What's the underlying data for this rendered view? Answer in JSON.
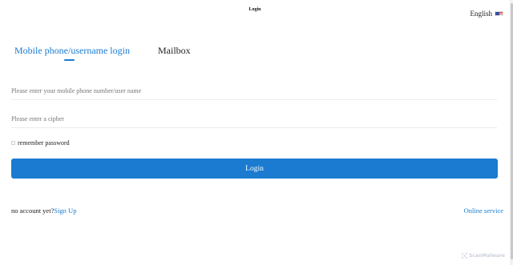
{
  "header": {
    "title": "Login",
    "language": "English",
    "flag_icon": "us-flag-icon"
  },
  "tabs": [
    {
      "label": "Mobile phone/username login",
      "active": true
    },
    {
      "label": "Mailbox",
      "active": false
    }
  ],
  "form": {
    "username_placeholder": "Please enter your mobile phone number/user name",
    "username_value": "",
    "password_placeholder": "Please enter a cipher",
    "password_value": "",
    "remember_label": "remember password",
    "remember_checked": false,
    "login_label": "Login"
  },
  "footer": {
    "no_account_text": "no account yet?",
    "signup_label": "Sign Up",
    "online_service_label": "Online service"
  },
  "watermark": {
    "text": "ScanMalware",
    "icon": "scan-logo-icon"
  },
  "colors": {
    "accent": "#1a7bd1",
    "text": "#222222",
    "placeholder": "#777777",
    "divider": "#ececec"
  }
}
